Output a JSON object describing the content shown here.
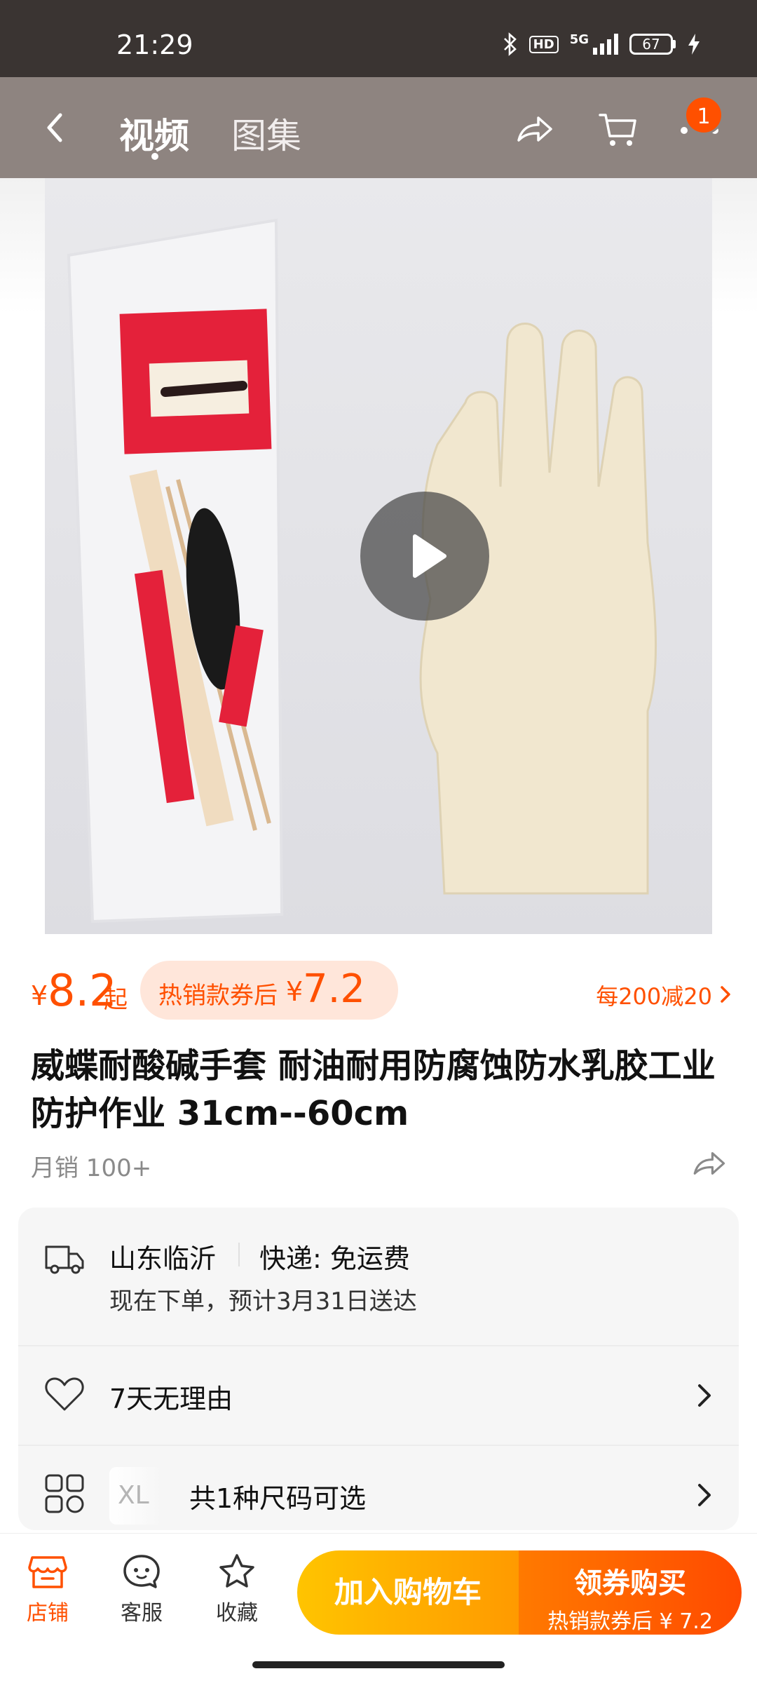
{
  "status_bar": {
    "time": "21:29",
    "hd": "HD",
    "network": "5G",
    "battery": "67"
  },
  "nav": {
    "tabs": [
      "视频",
      "图集"
    ],
    "active_tab": "视频",
    "cart_badge": "1"
  },
  "media": {
    "type": "video",
    "icon": "play-icon"
  },
  "price": {
    "currency": "¥",
    "value": "8.2",
    "suffix": "起",
    "coupon_label": "热销款券后",
    "coupon_currency": "¥",
    "coupon_value": "7.2",
    "promo": "每200减20"
  },
  "product": {
    "title": "威蝶耐酸碱手套 耐油耐用防腐蚀防水乳胶工业防护作业 31cm--60cm",
    "sales": "月销 100+"
  },
  "info": {
    "origin": "山东临沂",
    "express": "快递: 免运费",
    "eta": "现在下单，预计3月31日送达",
    "return_policy": "7天无理由",
    "size_tag": "XL",
    "size_text": "共1种尺码可选"
  },
  "bottom_bar": {
    "shop": "店铺",
    "service": "客服",
    "favorite": "收藏",
    "add_to_cart": "加入购物车",
    "buy_title": "领券购买",
    "buy_sub": "热销款券后 ¥ 7.2"
  },
  "colors": {
    "accent": "#ff5000",
    "cart_button": "#ffb300",
    "buy_button": "#ff5a00",
    "nav_background": "#8e8480"
  }
}
